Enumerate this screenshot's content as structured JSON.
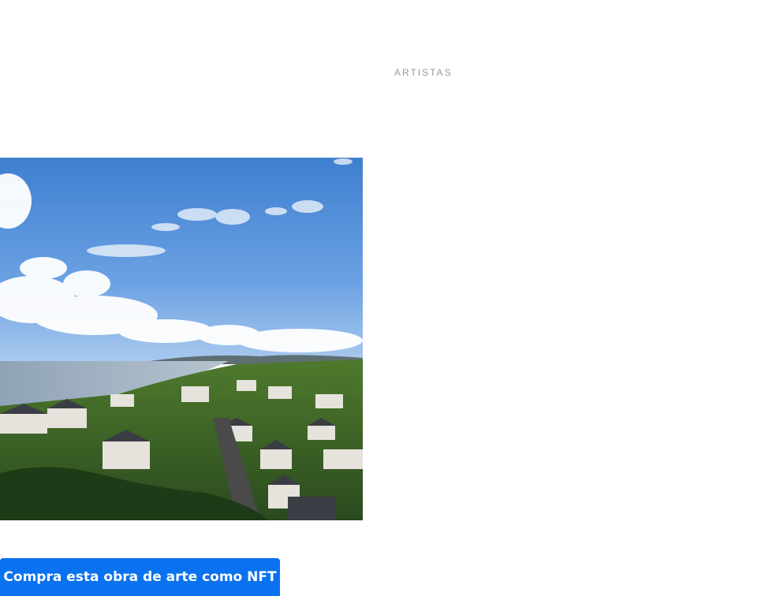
{
  "nav": {
    "artists_label": "ARTISTAS"
  },
  "artwork": {
    "description": "coastal-town-landscape-photo"
  },
  "cta": {
    "buy_label": "Compra esta obra de arte como NFT",
    "color": "#0a72ef"
  }
}
